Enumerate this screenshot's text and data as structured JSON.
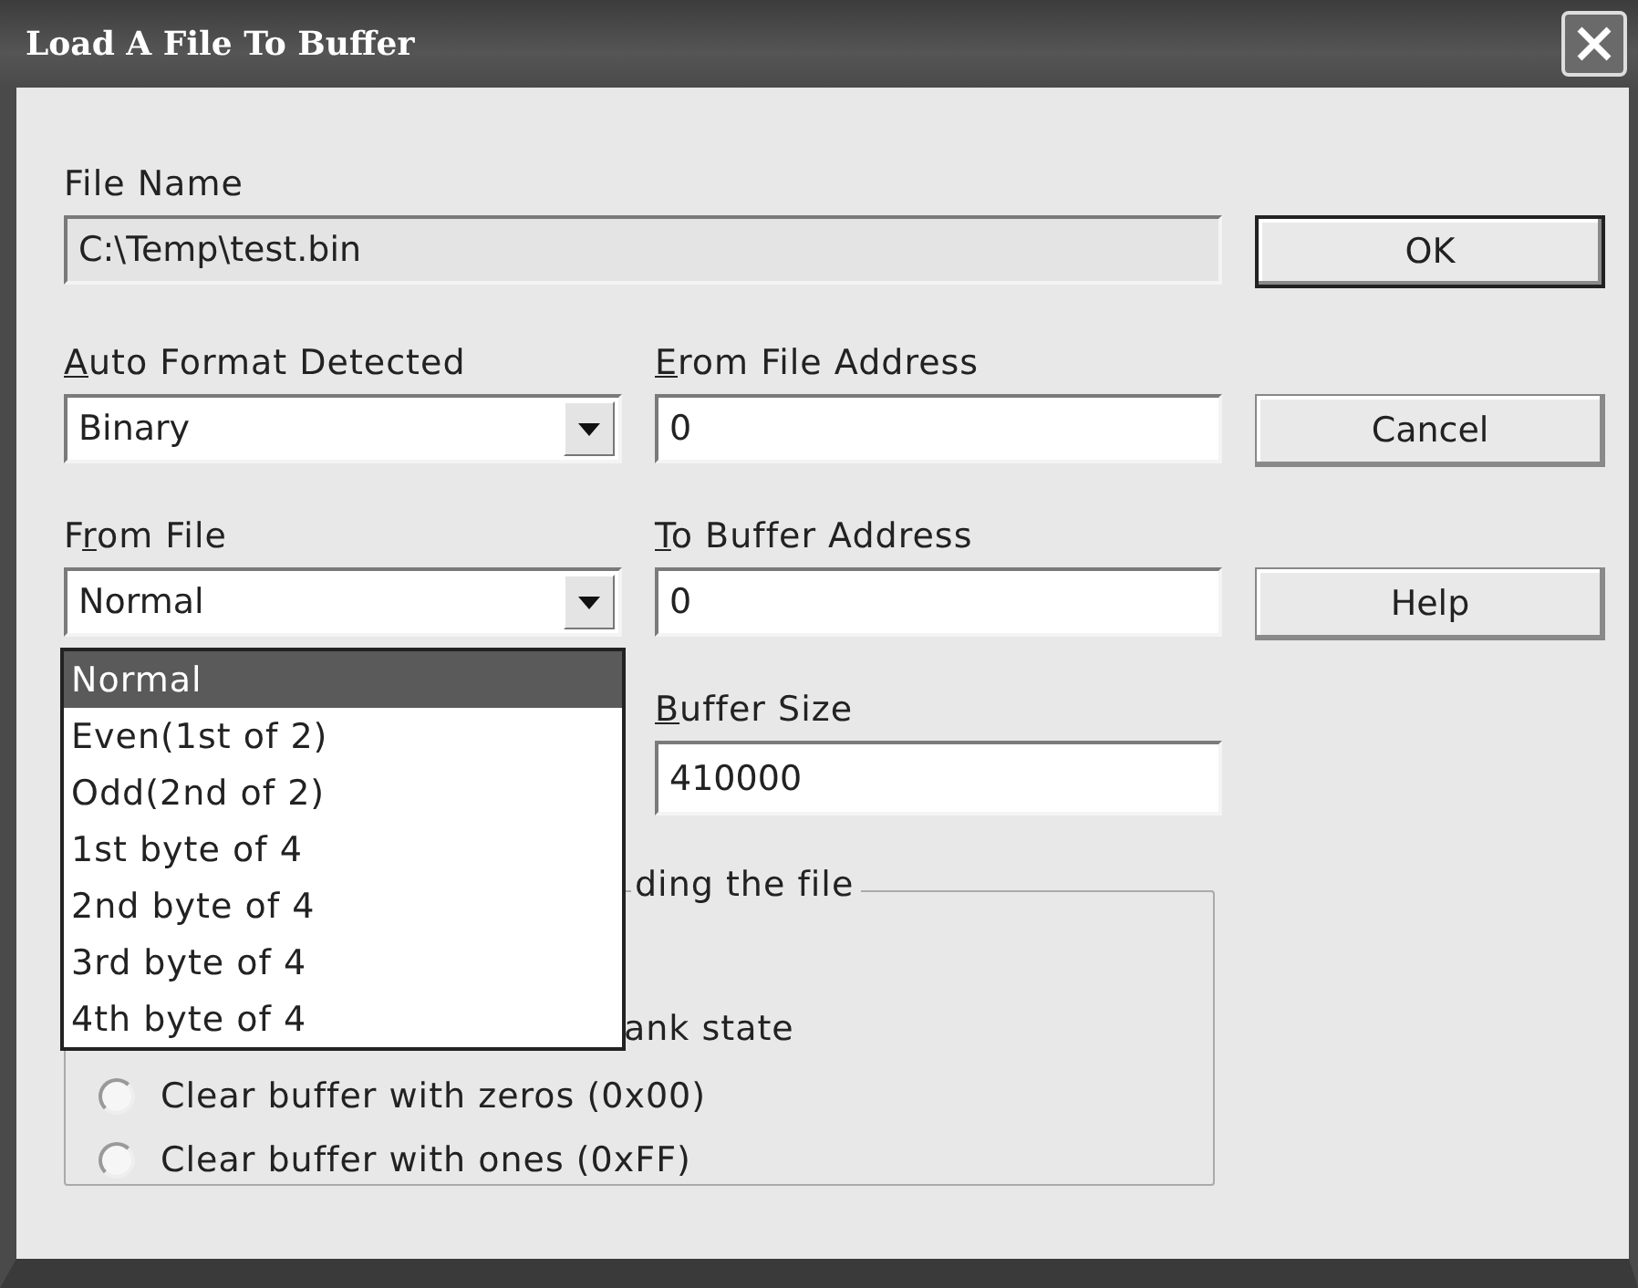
{
  "window": {
    "title": "Load A File To Buffer"
  },
  "file_name": {
    "label": {
      "before": "File Name"
    },
    "value": "C:\\Temp\\test.bin",
    "disabled": true
  },
  "auto_format": {
    "label": {
      "key": "A",
      "after": "uto Format Detected"
    },
    "value": "Binary"
  },
  "from_file_address": {
    "label": {
      "key": "E",
      "after": "rom File Address"
    },
    "value": "0"
  },
  "from_file": {
    "label": {
      "before": "F",
      "key": "r",
      "after": "om File"
    },
    "value": "Normal",
    "expanded": true,
    "options": [
      {
        "label": "Normal",
        "selected": true
      },
      {
        "label": "Even(1st of 2)",
        "selected": false
      },
      {
        "label": "Odd(2nd of 2)",
        "selected": false
      },
      {
        "label": "1st byte of 4",
        "selected": false
      },
      {
        "label": "2nd byte of 4",
        "selected": false
      },
      {
        "label": "3rd byte of 4",
        "selected": false
      },
      {
        "label": "4th byte of 4",
        "selected": false
      }
    ]
  },
  "to_buffer_address": {
    "label": {
      "key": "T",
      "after": "o Buffer Address"
    },
    "value": "0"
  },
  "buffer_size": {
    "label": {
      "key": "B",
      "after": "uffer Size"
    },
    "value": "410000"
  },
  "group": {
    "legend": "ding the file",
    "partial_line": "ank state",
    "radios": [
      {
        "label": "Clear buffer with zeros (0x00)",
        "selected": false
      },
      {
        "label": "Clear buffer with ones (0xFF)",
        "selected": false
      }
    ]
  },
  "buttons": [
    {
      "label": "OK",
      "default": true
    },
    {
      "label": "Cancel",
      "default": false
    },
    {
      "label": "Help",
      "default": false
    }
  ]
}
